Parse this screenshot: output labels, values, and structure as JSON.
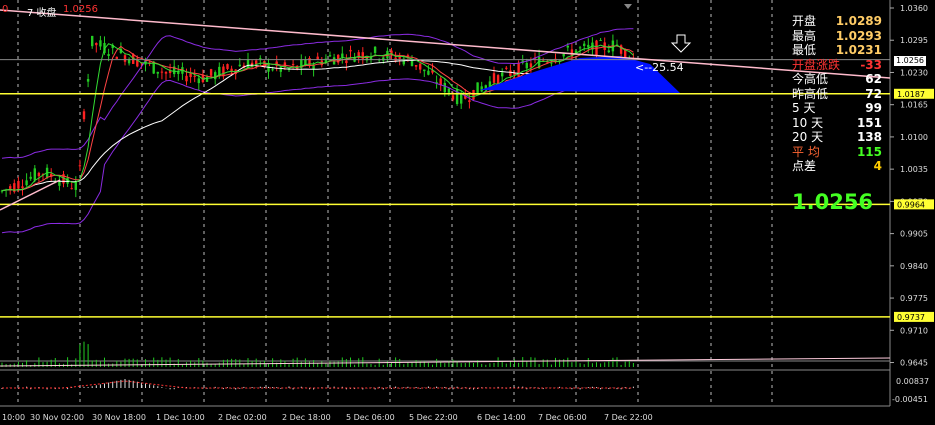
{
  "header": {
    "prefix": "0",
    "series_label": "7 收盘",
    "series_value": "1.0256"
  },
  "stats": {
    "rows": [
      {
        "label": "开盘",
        "value": "1.0289",
        "label_color": "#ffffff",
        "value_color": "#ffcc66"
      },
      {
        "label": "最高",
        "value": "1.0293",
        "label_color": "#ffffff",
        "value_color": "#ffcc66"
      },
      {
        "label": "最低",
        "value": "1.0231",
        "label_color": "#ffffff",
        "value_color": "#ffcc66"
      },
      {
        "label": "开盘涨跌",
        "value": "-33",
        "label_color": "#ff3333",
        "value_color": "#ff3333"
      },
      {
        "label": "今高低",
        "value": "62",
        "label_color": "#ffffff",
        "value_color": "#ffffff"
      },
      {
        "label": "昨高低",
        "value": "72",
        "label_color": "#ffffff",
        "value_color": "#ffffff"
      },
      {
        "label": "5  天",
        "value": "99",
        "label_color": "#ffffff",
        "value_color": "#ffffff"
      },
      {
        "label": "10 天",
        "value": "151",
        "label_color": "#ffffff",
        "value_color": "#ffffff"
      },
      {
        "label": "20 天",
        "value": "138",
        "label_color": "#ffffff",
        "value_color": "#ffffff"
      },
      {
        "label": "平  均",
        "value": "115",
        "label_color": "#ff6633",
        "value_color": "#44ff22"
      },
      {
        "label": "点差",
        "value": "4",
        "label_color": "#ffffff",
        "value_color": "#ffcc00"
      }
    ],
    "current_price": "1.0256"
  },
  "annotation": "<--25.54",
  "colors": {
    "up_candle": "#22cc22",
    "down_candle": "#ff2222",
    "trendline": "#ffbbcc",
    "hline": "#ffff33",
    "bollinger": "#8a2be2",
    "ma_white": "#ffffff",
    "fill": "#0011ff"
  },
  "chart_data": {
    "type": "candlestick",
    "title": "",
    "ylim": [
      0.964,
      1.036
    ],
    "y_ticks": [
      "1.0360",
      "1.0295",
      "1.0230",
      "1.0165",
      "1.0100",
      "1.0035",
      "0.9970",
      "0.9905",
      "0.9840",
      "0.9775",
      "0.9710",
      "0.9645"
    ],
    "x_ticks": [
      "10:00",
      "30 Nov 02:00",
      "30 Nov 18:00",
      "1 Dec 10:00",
      "2 Dec 02:00",
      "2 Dec 18:00",
      "5 Dec 06:00",
      "5 Dec 22:00",
      "6 Dec 14:00",
      "7 Dec 06:00",
      "7 Dec 22:00"
    ],
    "current_price_label": "1.0256",
    "horizontal_levels": [
      {
        "value": 1.0187,
        "label": "1.0187"
      },
      {
        "value": 0.9964,
        "label": "0.9964"
      },
      {
        "value": 0.9737,
        "label": "0.9737"
      }
    ],
    "sub_indicator": {
      "ticks": [
        "0.00837",
        "-0.00451"
      ]
    }
  }
}
